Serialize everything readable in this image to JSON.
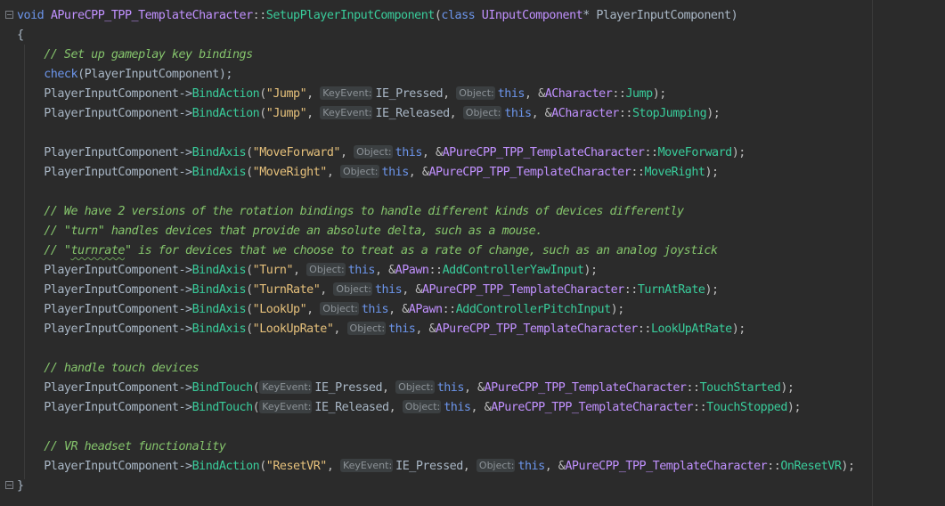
{
  "colors": {
    "background": "#2b2b2b",
    "default": "#a9b7c6",
    "keyword": "#6c95eb",
    "class": "#c191ff",
    "function": "#39cc9b",
    "string": "#e5c07b",
    "comment": "#85c46c",
    "punct": "#bdbdbd",
    "hint_bg": "#3b3f41",
    "hint_fg": "#8c9297"
  },
  "code": {
    "lines": [
      [
        {
          "t": "void ",
          "k": "keyword"
        },
        {
          "t": "APureCPP_TPP_TemplateCharacter",
          "k": "class"
        },
        {
          "t": "::",
          "k": "punct"
        },
        {
          "t": "SetupPlayerInputComponent",
          "k": "function"
        },
        {
          "t": "(",
          "k": "punct"
        },
        {
          "t": "class ",
          "k": "keyword"
        },
        {
          "t": "UInputComponent",
          "k": "class"
        },
        {
          "t": "* PlayerInputComponent)",
          "k": "default"
        }
      ],
      [
        {
          "t": "{",
          "k": "default"
        }
      ],
      [
        {
          "t": "    // Set up gameplay key bindings",
          "k": "comment"
        }
      ],
      [
        {
          "t": "    ",
          "k": "default"
        },
        {
          "t": "check",
          "k": "keyword"
        },
        {
          "t": "(PlayerInputComponent);",
          "k": "default"
        }
      ],
      [
        {
          "t": "    PlayerInputComponent->",
          "k": "default"
        },
        {
          "t": "BindAction",
          "k": "function"
        },
        {
          "t": "(",
          "k": "punct"
        },
        {
          "t": "\"Jump\"",
          "k": "string"
        },
        {
          "t": ", ",
          "k": "punct"
        },
        {
          "t": "KeyEvent:",
          "k": "hint"
        },
        {
          "t": "IE_Pressed",
          "k": "default"
        },
        {
          "t": ", ",
          "k": "punct"
        },
        {
          "t": "Object:",
          "k": "hint"
        },
        {
          "t": "this",
          "k": "keyword"
        },
        {
          "t": ", &",
          "k": "punct"
        },
        {
          "t": "ACharacter",
          "k": "class"
        },
        {
          "t": "::",
          "k": "punct"
        },
        {
          "t": "Jump",
          "k": "function"
        },
        {
          "t": ");",
          "k": "punct"
        }
      ],
      [
        {
          "t": "    PlayerInputComponent->",
          "k": "default"
        },
        {
          "t": "BindAction",
          "k": "function"
        },
        {
          "t": "(",
          "k": "punct"
        },
        {
          "t": "\"Jump\"",
          "k": "string"
        },
        {
          "t": ", ",
          "k": "punct"
        },
        {
          "t": "KeyEvent:",
          "k": "hint"
        },
        {
          "t": "IE_Released",
          "k": "default"
        },
        {
          "t": ", ",
          "k": "punct"
        },
        {
          "t": "Object:",
          "k": "hint"
        },
        {
          "t": "this",
          "k": "keyword"
        },
        {
          "t": ", &",
          "k": "punct"
        },
        {
          "t": "ACharacter",
          "k": "class"
        },
        {
          "t": "::",
          "k": "punct"
        },
        {
          "t": "StopJumping",
          "k": "function"
        },
        {
          "t": ");",
          "k": "punct"
        }
      ],
      [],
      [
        {
          "t": "    PlayerInputComponent->",
          "k": "default"
        },
        {
          "t": "BindAxis",
          "k": "function"
        },
        {
          "t": "(",
          "k": "punct"
        },
        {
          "t": "\"MoveForward\"",
          "k": "string"
        },
        {
          "t": ", ",
          "k": "punct"
        },
        {
          "t": "Object:",
          "k": "hint"
        },
        {
          "t": "this",
          "k": "keyword"
        },
        {
          "t": ", &",
          "k": "punct"
        },
        {
          "t": "APureCPP_TPP_TemplateCharacter",
          "k": "class"
        },
        {
          "t": "::",
          "k": "punct"
        },
        {
          "t": "MoveForward",
          "k": "function"
        },
        {
          "t": ");",
          "k": "punct"
        }
      ],
      [
        {
          "t": "    PlayerInputComponent->",
          "k": "default"
        },
        {
          "t": "BindAxis",
          "k": "function"
        },
        {
          "t": "(",
          "k": "punct"
        },
        {
          "t": "\"MoveRight\"",
          "k": "string"
        },
        {
          "t": ", ",
          "k": "punct"
        },
        {
          "t": "Object:",
          "k": "hint"
        },
        {
          "t": "this",
          "k": "keyword"
        },
        {
          "t": ", &",
          "k": "punct"
        },
        {
          "t": "APureCPP_TPP_TemplateCharacter",
          "k": "class"
        },
        {
          "t": "::",
          "k": "punct"
        },
        {
          "t": "MoveRight",
          "k": "function"
        },
        {
          "t": ");",
          "k": "punct"
        }
      ],
      [],
      [
        {
          "t": "    // We have 2 versions of the rotation bindings to handle different kinds of devices differently",
          "k": "comment"
        }
      ],
      [
        {
          "t": "    // \"turn\" handles devices that provide an absolute delta, such as a mouse.",
          "k": "comment"
        }
      ],
      [
        {
          "t": "    // \"",
          "k": "comment"
        },
        {
          "t": "turnrate",
          "k": "comment-squiggle"
        },
        {
          "t": "\" is for devices that we choose to treat as a rate of change, such as an analog joystick",
          "k": "comment"
        }
      ],
      [
        {
          "t": "    PlayerInputComponent->",
          "k": "default"
        },
        {
          "t": "BindAxis",
          "k": "function"
        },
        {
          "t": "(",
          "k": "punct"
        },
        {
          "t": "\"Turn\"",
          "k": "string"
        },
        {
          "t": ", ",
          "k": "punct"
        },
        {
          "t": "Object:",
          "k": "hint"
        },
        {
          "t": "this",
          "k": "keyword"
        },
        {
          "t": ", &",
          "k": "punct"
        },
        {
          "t": "APawn",
          "k": "class"
        },
        {
          "t": "::",
          "k": "punct"
        },
        {
          "t": "AddControllerYawInput",
          "k": "function"
        },
        {
          "t": ");",
          "k": "punct"
        }
      ],
      [
        {
          "t": "    PlayerInputComponent->",
          "k": "default"
        },
        {
          "t": "BindAxis",
          "k": "function"
        },
        {
          "t": "(",
          "k": "punct"
        },
        {
          "t": "\"TurnRate\"",
          "k": "string"
        },
        {
          "t": ", ",
          "k": "punct"
        },
        {
          "t": "Object:",
          "k": "hint"
        },
        {
          "t": "this",
          "k": "keyword"
        },
        {
          "t": ", &",
          "k": "punct"
        },
        {
          "t": "APureCPP_TPP_TemplateCharacter",
          "k": "class"
        },
        {
          "t": "::",
          "k": "punct"
        },
        {
          "t": "TurnAtRate",
          "k": "function"
        },
        {
          "t": ");",
          "k": "punct"
        }
      ],
      [
        {
          "t": "    PlayerInputComponent->",
          "k": "default"
        },
        {
          "t": "BindAxis",
          "k": "function"
        },
        {
          "t": "(",
          "k": "punct"
        },
        {
          "t": "\"LookUp\"",
          "k": "string"
        },
        {
          "t": ", ",
          "k": "punct"
        },
        {
          "t": "Object:",
          "k": "hint"
        },
        {
          "t": "this",
          "k": "keyword"
        },
        {
          "t": ", &",
          "k": "punct"
        },
        {
          "t": "APawn",
          "k": "class"
        },
        {
          "t": "::",
          "k": "punct"
        },
        {
          "t": "AddControllerPitchInput",
          "k": "function"
        },
        {
          "t": ");",
          "k": "punct"
        }
      ],
      [
        {
          "t": "    PlayerInputComponent->",
          "k": "default"
        },
        {
          "t": "BindAxis",
          "k": "function"
        },
        {
          "t": "(",
          "k": "punct"
        },
        {
          "t": "\"LookUpRate\"",
          "k": "string"
        },
        {
          "t": ", ",
          "k": "punct"
        },
        {
          "t": "Object:",
          "k": "hint"
        },
        {
          "t": "this",
          "k": "keyword"
        },
        {
          "t": ", &",
          "k": "punct"
        },
        {
          "t": "APureCPP_TPP_TemplateCharacter",
          "k": "class"
        },
        {
          "t": "::",
          "k": "punct"
        },
        {
          "t": "LookUpAtRate",
          "k": "function"
        },
        {
          "t": ");",
          "k": "punct"
        }
      ],
      [],
      [
        {
          "t": "    // handle touch devices",
          "k": "comment"
        }
      ],
      [
        {
          "t": "    PlayerInputComponent->",
          "k": "default"
        },
        {
          "t": "BindTouch",
          "k": "function"
        },
        {
          "t": "(",
          "k": "punct"
        },
        {
          "t": "KeyEvent:",
          "k": "hint"
        },
        {
          "t": "IE_Pressed",
          "k": "default"
        },
        {
          "t": ", ",
          "k": "punct"
        },
        {
          "t": "Object:",
          "k": "hint"
        },
        {
          "t": "this",
          "k": "keyword"
        },
        {
          "t": ", &",
          "k": "punct"
        },
        {
          "t": "APureCPP_TPP_TemplateCharacter",
          "k": "class"
        },
        {
          "t": "::",
          "k": "punct"
        },
        {
          "t": "TouchStarted",
          "k": "function"
        },
        {
          "t": ");",
          "k": "punct"
        }
      ],
      [
        {
          "t": "    PlayerInputComponent->",
          "k": "default"
        },
        {
          "t": "BindTouch",
          "k": "function"
        },
        {
          "t": "(",
          "k": "punct"
        },
        {
          "t": "KeyEvent:",
          "k": "hint"
        },
        {
          "t": "IE_Released",
          "k": "default"
        },
        {
          "t": ", ",
          "k": "punct"
        },
        {
          "t": "Object:",
          "k": "hint"
        },
        {
          "t": "this",
          "k": "keyword"
        },
        {
          "t": ", &",
          "k": "punct"
        },
        {
          "t": "APureCPP_TPP_TemplateCharacter",
          "k": "class"
        },
        {
          "t": "::",
          "k": "punct"
        },
        {
          "t": "TouchStopped",
          "k": "function"
        },
        {
          "t": ");",
          "k": "punct"
        }
      ],
      [],
      [
        {
          "t": "    // VR headset functionality",
          "k": "comment"
        }
      ],
      [
        {
          "t": "    PlayerInputComponent->",
          "k": "default"
        },
        {
          "t": "BindAction",
          "k": "function"
        },
        {
          "t": "(",
          "k": "punct"
        },
        {
          "t": "\"ResetVR\"",
          "k": "string"
        },
        {
          "t": ", ",
          "k": "punct"
        },
        {
          "t": "KeyEvent:",
          "k": "hint"
        },
        {
          "t": "IE_Pressed",
          "k": "default"
        },
        {
          "t": ", ",
          "k": "punct"
        },
        {
          "t": "Object:",
          "k": "hint"
        },
        {
          "t": "this",
          "k": "keyword"
        },
        {
          "t": ", &",
          "k": "punct"
        },
        {
          "t": "APureCPP_TPP_TemplateCharacter",
          "k": "class"
        },
        {
          "t": "::",
          "k": "punct"
        },
        {
          "t": "OnResetVR",
          "k": "function"
        },
        {
          "t": ");",
          "k": "punct"
        }
      ],
      [
        {
          "t": "}",
          "k": "default"
        }
      ]
    ]
  },
  "gutter": {
    "top_icon": "fold-collapse-icon",
    "bottom_icon": "fold-end-icon"
  }
}
